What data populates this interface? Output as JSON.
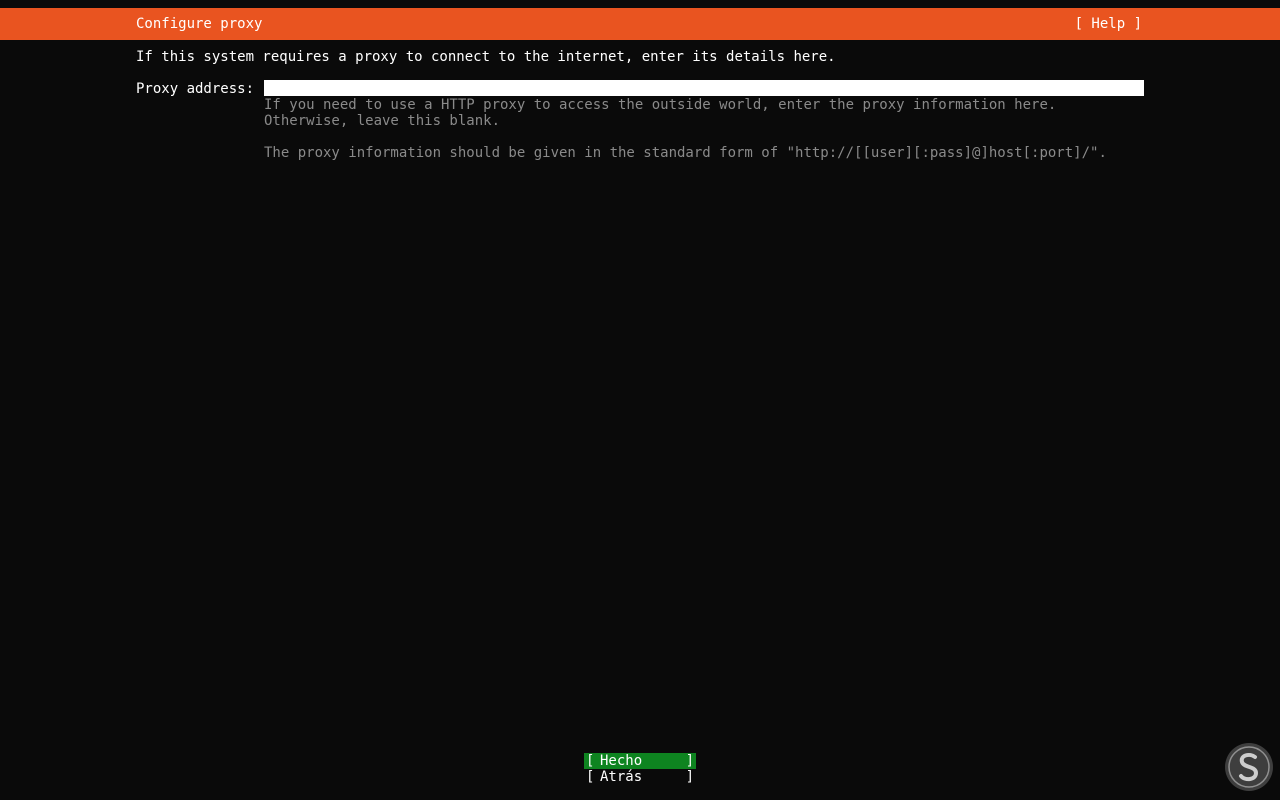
{
  "header": {
    "title": "Configure proxy",
    "help_label": "[ Help ]"
  },
  "intro_text": "If this system requires a proxy to connect to the internet, enter its details here.",
  "proxy_field": {
    "label": "Proxy address:",
    "value": ""
  },
  "hints": {
    "line1": "If you need to use a HTTP proxy to access the outside world, enter the proxy information here. Otherwise, leave this blank.",
    "line2": "The proxy information should be given in the standard form of \"http://[[user][:pass]@]host[:port]/\"."
  },
  "buttons": {
    "done_label": "Hecho",
    "back_label": "Atrás",
    "bracket_open": "[",
    "bracket_close": "]"
  },
  "colors": {
    "header_bg": "#e95420",
    "done_bg": "#0e8420",
    "background": "#0a0a0a",
    "hint_text": "#8a8a8a"
  },
  "icons": {
    "watermark": "solvetic-logo-icon"
  }
}
